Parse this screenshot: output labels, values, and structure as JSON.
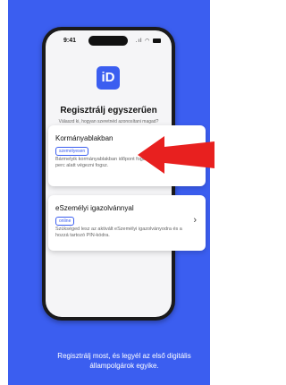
{
  "status_bar": {
    "time": "9:41",
    "icons": ".ıl ◠"
  },
  "logo": {
    "text": "iD"
  },
  "header": {
    "title": "Regisztrálj egyszerűen",
    "subtitle": "Válaszd ki, hogyan szeretnéd azonosítani magad?"
  },
  "options": [
    {
      "title": "Kormányablakban",
      "badge": "személyesen",
      "description": "Bármelyik kormányablakban időpont foglalás nélkül is kb. 20 perc alatt végezni fogsz."
    },
    {
      "title": "eSzemélyi igazolvánnyal",
      "badge": "online",
      "description": "Szükséged lesz az aktivált eSzemélyi igazolványodra és a hozzá tartozó PIN-kódra.",
      "chevron": "›"
    }
  ],
  "caption": "Regisztrálj most, és legyél az első digitális állampolgárok egyike.",
  "colors": {
    "background": "#3b5ef0",
    "arrow": "#e8201f",
    "accent": "#3b5ef0"
  }
}
